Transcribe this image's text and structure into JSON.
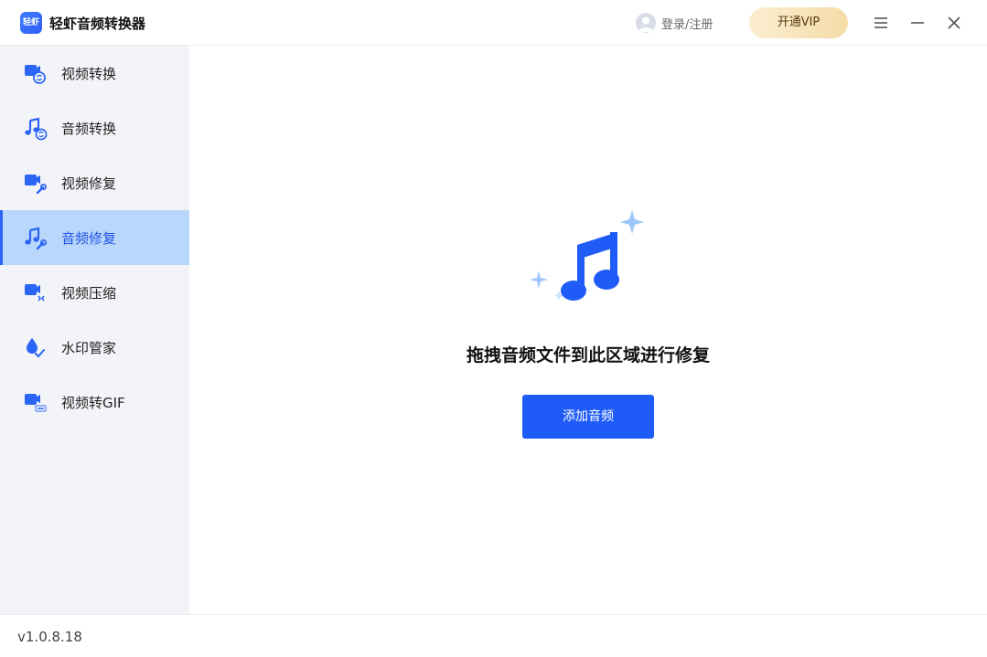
{
  "app": {
    "logo_text": "轻虾",
    "title": "轻虾音频转换器"
  },
  "header": {
    "login_label": "登录/注册",
    "vip_label": "开通VIP"
  },
  "colors": {
    "accent": "#1f5cf7",
    "sidebar_bg": "#f3f4f8",
    "active_bg": "#b9d6fb",
    "vip_gold": "#f5dca8"
  },
  "sidebar": {
    "items": [
      {
        "label": "视频转换",
        "icon": "video-convert-icon"
      },
      {
        "label": "音频转换",
        "icon": "audio-convert-icon"
      },
      {
        "label": "视频修复",
        "icon": "video-repair-icon"
      },
      {
        "label": "音频修复",
        "icon": "audio-repair-icon",
        "active": true
      },
      {
        "label": "视频压缩",
        "icon": "video-compress-icon"
      },
      {
        "label": "水印管家",
        "icon": "watermark-icon"
      },
      {
        "label": "视频转GIF",
        "icon": "video-gif-icon"
      }
    ]
  },
  "main": {
    "drop_text": "拖拽音频文件到此区域进行修复",
    "add_button": "添加音频"
  },
  "footer": {
    "version": "v1.0.8.18"
  }
}
